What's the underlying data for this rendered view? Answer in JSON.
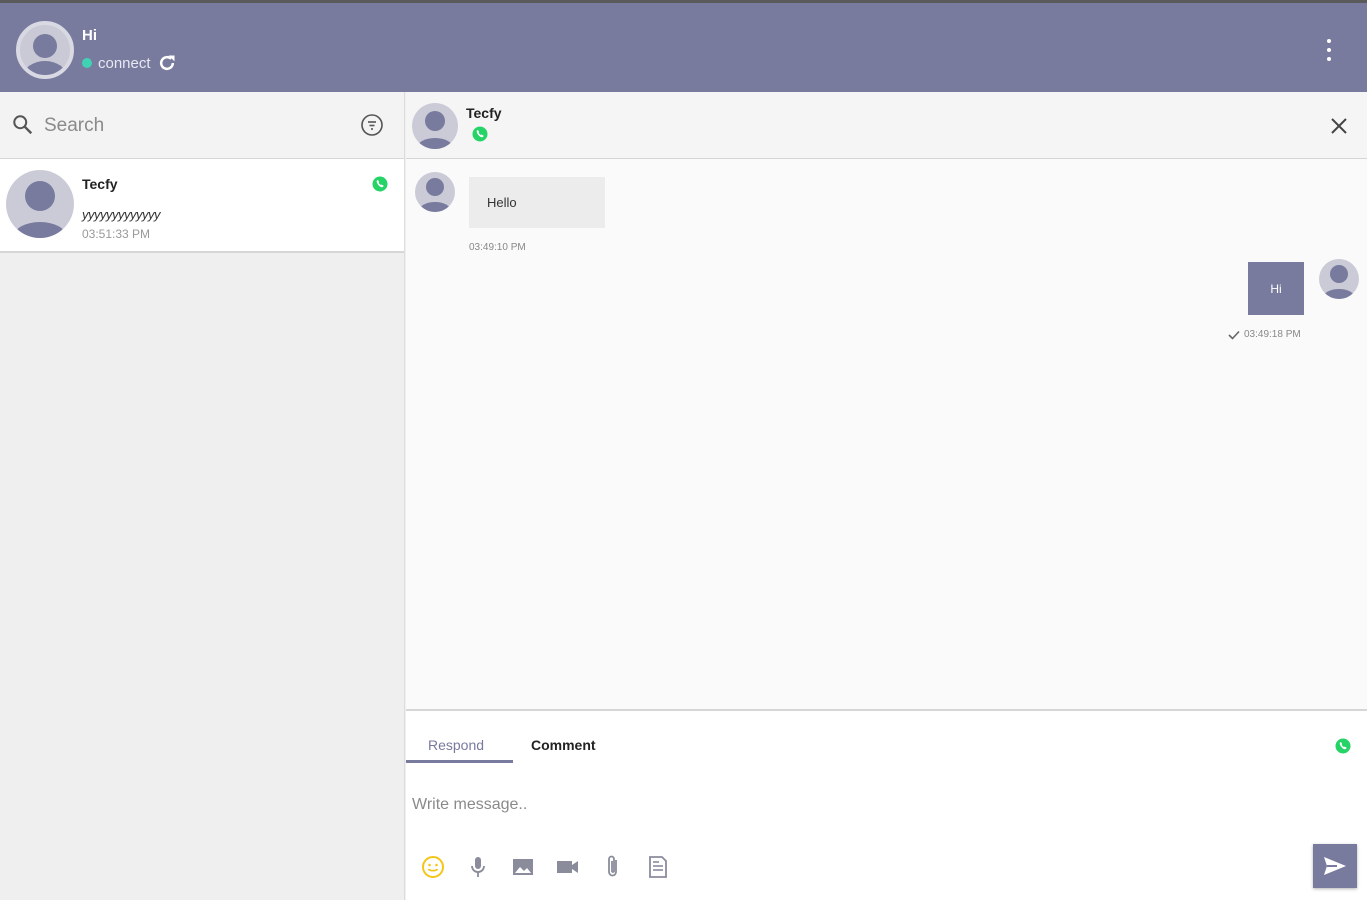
{
  "colors": {
    "brand": "#787a9e",
    "online": "#3fd3b4",
    "whatsapp": "#25d366",
    "emoji": "#f5c518",
    "icon_gray": "#8a8c9c"
  },
  "header": {
    "user_name": "Hi",
    "status_text": "connect",
    "refresh_icon": "refresh-icon",
    "menu_icon": "kebab-menu-icon"
  },
  "search": {
    "placeholder": "Search",
    "icon": "search-icon",
    "filter_icon": "filter-icon"
  },
  "conversations": [
    {
      "name": "Tecfy",
      "last_message": "yyyyyyyyyyyyy",
      "time": "03:51:33 PM",
      "channel_icon": "whatsapp-icon"
    }
  ],
  "chat": {
    "contact_name": "Tecfy",
    "channel_icon": "whatsapp-icon",
    "close_icon": "close-icon",
    "messages": [
      {
        "direction": "in",
        "text": "Hello",
        "time": "03:49:10 PM"
      },
      {
        "direction": "out",
        "text": "Hi",
        "time": "03:49:18 PM"
      }
    ]
  },
  "composer": {
    "tabs": [
      {
        "label": "Respond",
        "active": true
      },
      {
        "label": "Comment",
        "active": false
      }
    ],
    "placeholder": "Write message..",
    "tools": [
      "emoji-icon",
      "microphone-icon",
      "image-icon",
      "video-icon",
      "attachment-icon",
      "template-icon"
    ],
    "send_icon": "send-icon"
  }
}
